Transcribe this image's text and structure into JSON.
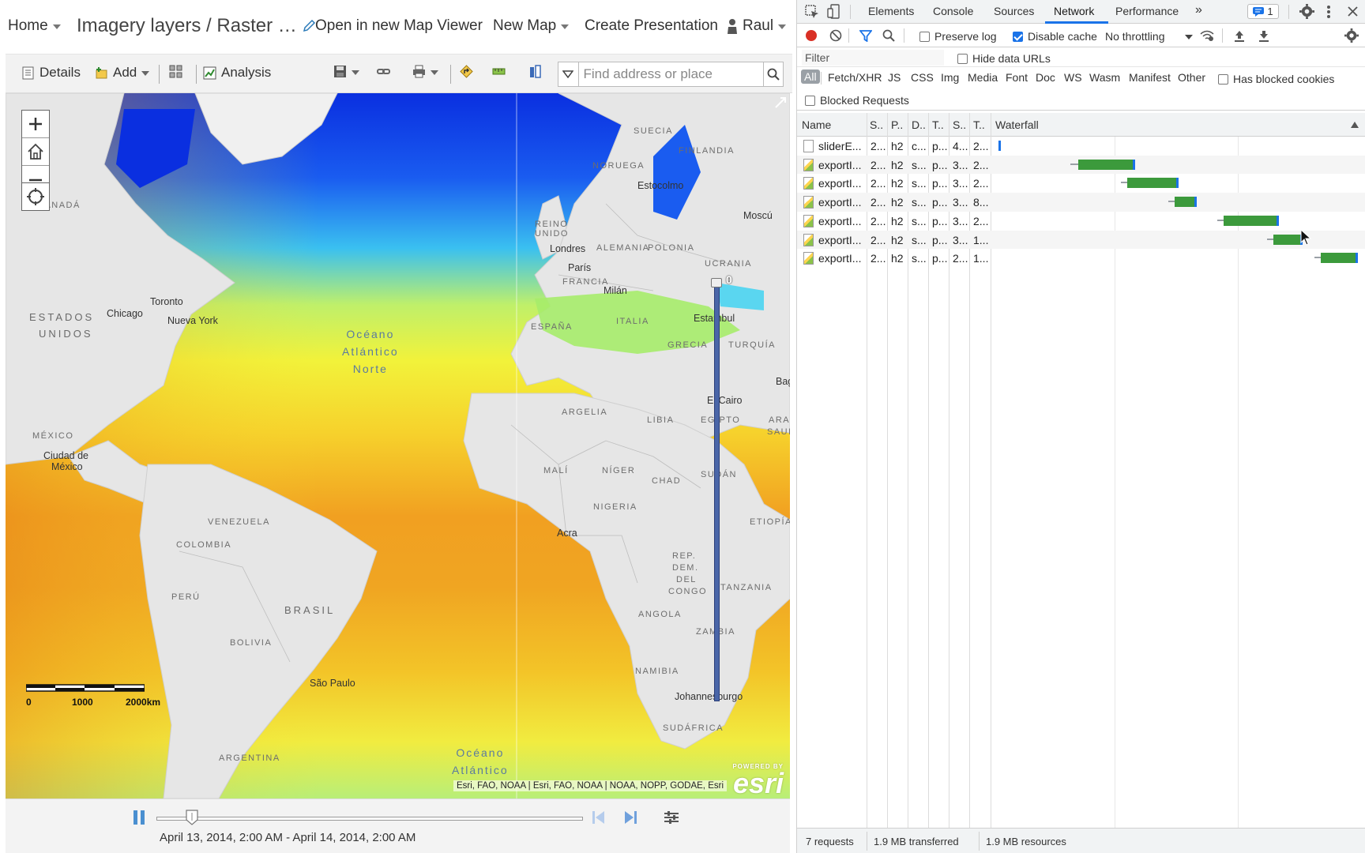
{
  "app": {
    "nav_home": "Home",
    "title": "Imagery layers / Raster …",
    "open_viewer": "Open in new Map Viewer",
    "new_map": "New Map",
    "create_presentation": "Create Presentation",
    "user": "Raul"
  },
  "toolbar": {
    "details": "Details",
    "add": "Add",
    "analysis": "Analysis",
    "search_placeholder": "Find address or place"
  },
  "map": {
    "labels": {
      "canada": "CANADÁ",
      "suecia": "SUECIA",
      "finlandia": "FINLANDIA",
      "noruega": "NORUEGA",
      "estocolmo": "Estocolmo",
      "moscu": "Moscú",
      "reino_unido": "REINO UNIDO",
      "polonia": "POLONIA",
      "londres": "Londres",
      "alemania": "ALEMANIA",
      "paris": "París",
      "ucrania": "UCRANIA",
      "francia": "FRANCIA",
      "milan": "Milán",
      "toronto": "Toronto",
      "estados": "ESTADOS",
      "unidos": "UNIDOS",
      "chicago": "Chicago",
      "nueva_york": "Nueva York",
      "espana": "ESPAÑA",
      "italia": "ITALIA",
      "estambul": "Estambul",
      "grecia": "GRECIA",
      "turquia": "TURQUÍA",
      "ocean_north_1": "Océano",
      "ocean_north_2": "Atlántico",
      "ocean_north_3": "Norte",
      "bag": "Bag",
      "argelia": "ARGELIA",
      "libia": "LIBIA",
      "el_cairo": "El Cairo",
      "egipto": "EGIPTO",
      "ara": "ARA",
      "saud": "SAUD",
      "mexico": "MÉXICO",
      "ciudad_de": "Ciudad de",
      "mexico_city": "México",
      "mali": "MALÍ",
      "niger": "NÍGER",
      "chad": "CHAD",
      "sudan": "SUDÁN",
      "nigeria": "NIGERIA",
      "venezuela": "VENEZUELA",
      "etiopia": "ETIOPÍA",
      "colombia": "COLOMBIA",
      "acra": "Acra",
      "rep": "REP.",
      "dem": "DEM.",
      "del": "DEL",
      "congo": "CONGO",
      "tanzania": "TANZANIA",
      "peru": "PERÚ",
      "brasil": "BRASIL",
      "angola": "ANGOLA",
      "bolivia": "BOLIVIA",
      "zambia": "ZAMBIA",
      "namibia": "NAMIBIA",
      "sao_paulo": "São Paulo",
      "johannesburgo": "Johannesburgo",
      "sudafrica": "SUDÁFRICA",
      "argentina": "ARGENTINA",
      "ocean_south_1": "Océano",
      "ocean_south_2": "Atlántico"
    },
    "scale": {
      "t0": "0",
      "t1": "1000",
      "t2": "2000km"
    },
    "attribution": "Esri, FAO, NOAA | Esri, FAO, NOAA | NOAA, NOPP, GODAE, Esri",
    "powered_by": "POWERED BY",
    "esri": "esri",
    "swipe_value": "0"
  },
  "time_slider": {
    "label": "April 13, 2014, 2:00 AM - April 14, 2014, 2:00 AM"
  },
  "devtools": {
    "tabs": [
      "Elements",
      "Console",
      "Sources",
      "Network",
      "Performance"
    ],
    "more": "»",
    "issues_count": "1",
    "preserve_log": "Preserve log",
    "disable_cache": "Disable cache",
    "throttling": "No throttling",
    "filter_placeholder": "Filter",
    "hide_data_urls": "Hide data URLs",
    "types": [
      "All",
      "Fetch/XHR",
      "JS",
      "CSS",
      "Img",
      "Media",
      "Font",
      "Doc",
      "WS",
      "Wasm",
      "Manifest",
      "Other"
    ],
    "has_blocked_cookies": "Has blocked cookies",
    "blocked_requests": "Blocked Requests",
    "columns": [
      "Name",
      "S..",
      "P..",
      "D..",
      "T..",
      "S..",
      "T..",
      "Waterfall"
    ],
    "rows": [
      {
        "name": "sliderE...",
        "c1": "2...",
        "c2": "h2",
        "c3": "c...",
        "c4": "p...",
        "c5": "4...",
        "c6": "2...",
        "icon": "doc"
      },
      {
        "name": "exportI...",
        "c1": "2...",
        "c2": "h2",
        "c3": "s...",
        "c4": "p...",
        "c5": "3...",
        "c6": "2...",
        "icon": "img"
      },
      {
        "name": "exportI...",
        "c1": "2...",
        "c2": "h2",
        "c3": "s...",
        "c4": "p...",
        "c5": "3...",
        "c6": "2...",
        "icon": "img"
      },
      {
        "name": "exportI...",
        "c1": "2...",
        "c2": "h2",
        "c3": "s...",
        "c4": "p...",
        "c5": "3...",
        "c6": "8...",
        "icon": "img"
      },
      {
        "name": "exportI...",
        "c1": "2...",
        "c2": "h2",
        "c3": "s...",
        "c4": "p...",
        "c5": "3...",
        "c6": "2...",
        "icon": "img"
      },
      {
        "name": "exportI...",
        "c1": "2...",
        "c2": "h2",
        "c3": "s...",
        "c4": "p...",
        "c5": "3...",
        "c6": "1...",
        "icon": "img"
      },
      {
        "name": "exportI...",
        "c1": "2...",
        "c2": "h2",
        "c3": "s...",
        "c4": "p...",
        "c5": "2...",
        "c6": "1...",
        "icon": "img"
      }
    ],
    "status": {
      "requests": "7 requests",
      "transferred": "1.9 MB transferred",
      "resources": "1.9 MB resources"
    }
  },
  "colors": {
    "accent": "#1a73e8",
    "waterfall_bar": "#3c9a3c",
    "swipe_bar": "#4a66a8"
  }
}
